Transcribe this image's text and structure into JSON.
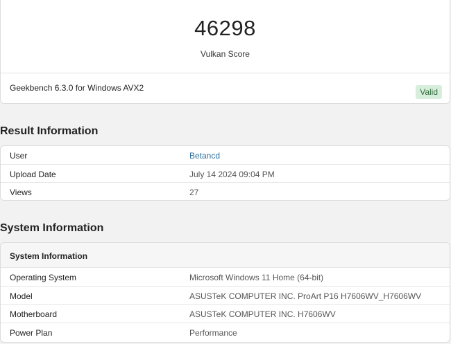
{
  "score": {
    "value": "46298",
    "label": "Vulkan Score",
    "version": "Geekbench 6.3.0 for Windows AVX2",
    "badge": "Valid"
  },
  "result": {
    "heading": "Result Information",
    "rows": [
      {
        "key": "User",
        "value": "Betancd"
      },
      {
        "key": "Upload Date",
        "value": "July 14 2024 09:04 PM"
      },
      {
        "key": "Views",
        "value": "27"
      }
    ]
  },
  "system": {
    "heading": "System Information",
    "table_header": "System Information",
    "rows": [
      {
        "key": "Operating System",
        "value": "Microsoft Windows 11 Home (64-bit)"
      },
      {
        "key": "Model",
        "value": "ASUSTeK COMPUTER INC. ProArt P16 H7606WV_H7606WV"
      },
      {
        "key": "Motherboard",
        "value": "ASUSTeK COMPUTER INC. H7606WV"
      },
      {
        "key": "Power Plan",
        "value": "Performance"
      }
    ]
  },
  "colors": {
    "link": "#2a6e9c",
    "valid_bg": "#d8eedd",
    "valid_text": "#2e6b3a",
    "page_bg": "#f2f2f2"
  }
}
